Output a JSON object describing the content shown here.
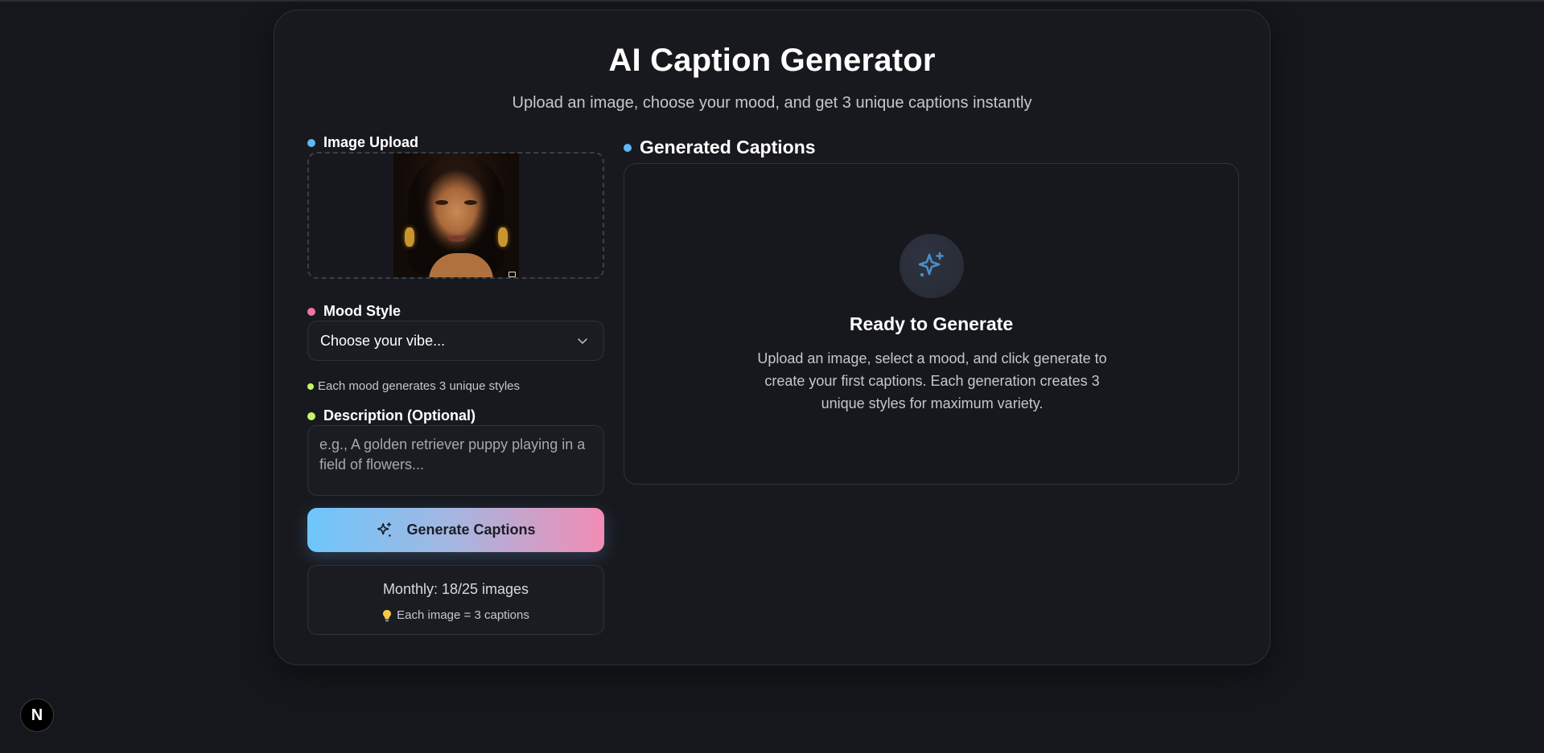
{
  "header": {
    "title": "AI Caption Generator",
    "subtitle": "Upload an image, choose your mood, and get 3 unique captions instantly"
  },
  "upload": {
    "label": "Image Upload",
    "dot_color": "#60b7f5"
  },
  "mood": {
    "label": "Mood Style",
    "dot_color": "#f472a6",
    "selected": "Choose your vibe...",
    "hint": "Each mood generates 3 unique styles",
    "hint_dot_color": "#c7f36a"
  },
  "description": {
    "label": "Description (Optional)",
    "dot_color": "#c7f36a",
    "placeholder": "e.g., A golden retriever puppy playing in a field of flowers..."
  },
  "generate_button": {
    "label": "Generate Captions",
    "icon": "sparkles-icon"
  },
  "quota": {
    "monthly": "Monthly: 18/25 images",
    "tip": "Each image = 3 captions",
    "tip_icon": "lightbulb-icon"
  },
  "results": {
    "label": "Generated Captions",
    "dot_color": "#60b7f5",
    "empty_title": "Ready to Generate",
    "empty_text": "Upload an image, select a mood, and click generate to create your first captions. Each generation creates 3 unique styles for maximum variety.",
    "icon": "sparkles-icon"
  },
  "devtools": {
    "badge": "N"
  }
}
